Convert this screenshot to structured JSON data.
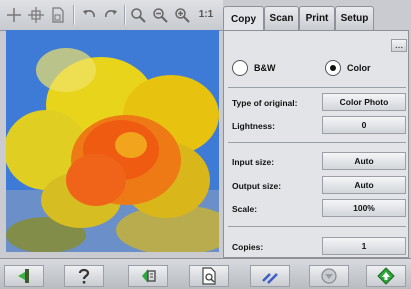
{
  "toolbar": {
    "icons": [
      "crosshair-icon",
      "move-icon",
      "page-icon",
      "rotate-left-icon",
      "rotate-right-icon",
      "zoom-fit-icon",
      "zoom-out-icon",
      "zoom-in-icon",
      "actual-size-icon"
    ],
    "actual_size_text": "1:1"
  },
  "tabs": [
    {
      "label": "Copy",
      "active": true
    },
    {
      "label": "Scan",
      "active": false
    },
    {
      "label": "Print",
      "active": false
    },
    {
      "label": "Setup",
      "active": false
    }
  ],
  "panel": {
    "more_label": "...",
    "color_mode": {
      "bw_label": "B&W",
      "color_label": "Color",
      "selected": "Color"
    },
    "type_of_original": {
      "label": "Type of original:",
      "value": "Color Photo"
    },
    "lightness": {
      "label": "Lightness:",
      "value": "0"
    },
    "input_size": {
      "label": "Input size:",
      "value": "Auto"
    },
    "output_size": {
      "label": "Output size:",
      "value": "Auto"
    },
    "scale": {
      "label": "Scale:",
      "value": "100%"
    },
    "copies": {
      "label": "Copies:",
      "value": "1"
    }
  },
  "bottom_icons": [
    "exit-icon",
    "help-icon",
    "preview-icon",
    "page-preview-icon",
    "settings-icon",
    "stop-icon",
    "start-icon"
  ],
  "colors": {
    "start_green": "#2fa63a",
    "accent_blue": "#3f5fc7"
  }
}
